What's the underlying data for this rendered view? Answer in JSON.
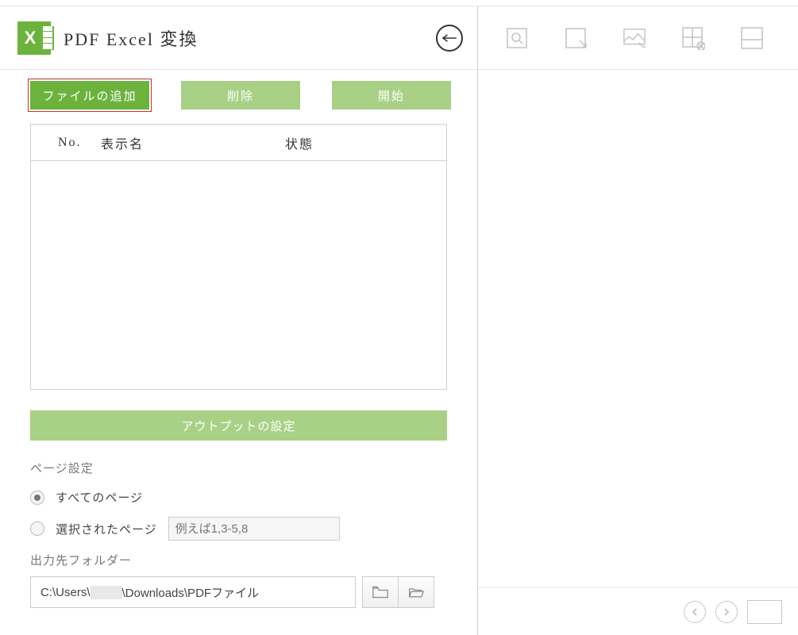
{
  "header": {
    "title": "PDF Excel 変換"
  },
  "buttons": {
    "add_file": "ファイルの追加",
    "delete": "削除",
    "start": "開始"
  },
  "table": {
    "col_no": "No.",
    "col_name": "表示名",
    "col_status": "状態"
  },
  "output": {
    "section_button": "アウトプットの設定",
    "page_settings_label": "ページ設定",
    "radio_all": "すべてのページ",
    "radio_selected": "選択されたページ",
    "range_placeholder": "例えば1,3-5,8",
    "output_folder_label": "出力先フォルダー",
    "output_folder_value_prefix": "C:\\Users\\",
    "output_folder_value_suffix": "\\Downloads\\PDFファイル"
  },
  "colors": {
    "accent": "#6cb33e",
    "accent_light": "#a9d186",
    "highlight_border": "#c53030"
  }
}
